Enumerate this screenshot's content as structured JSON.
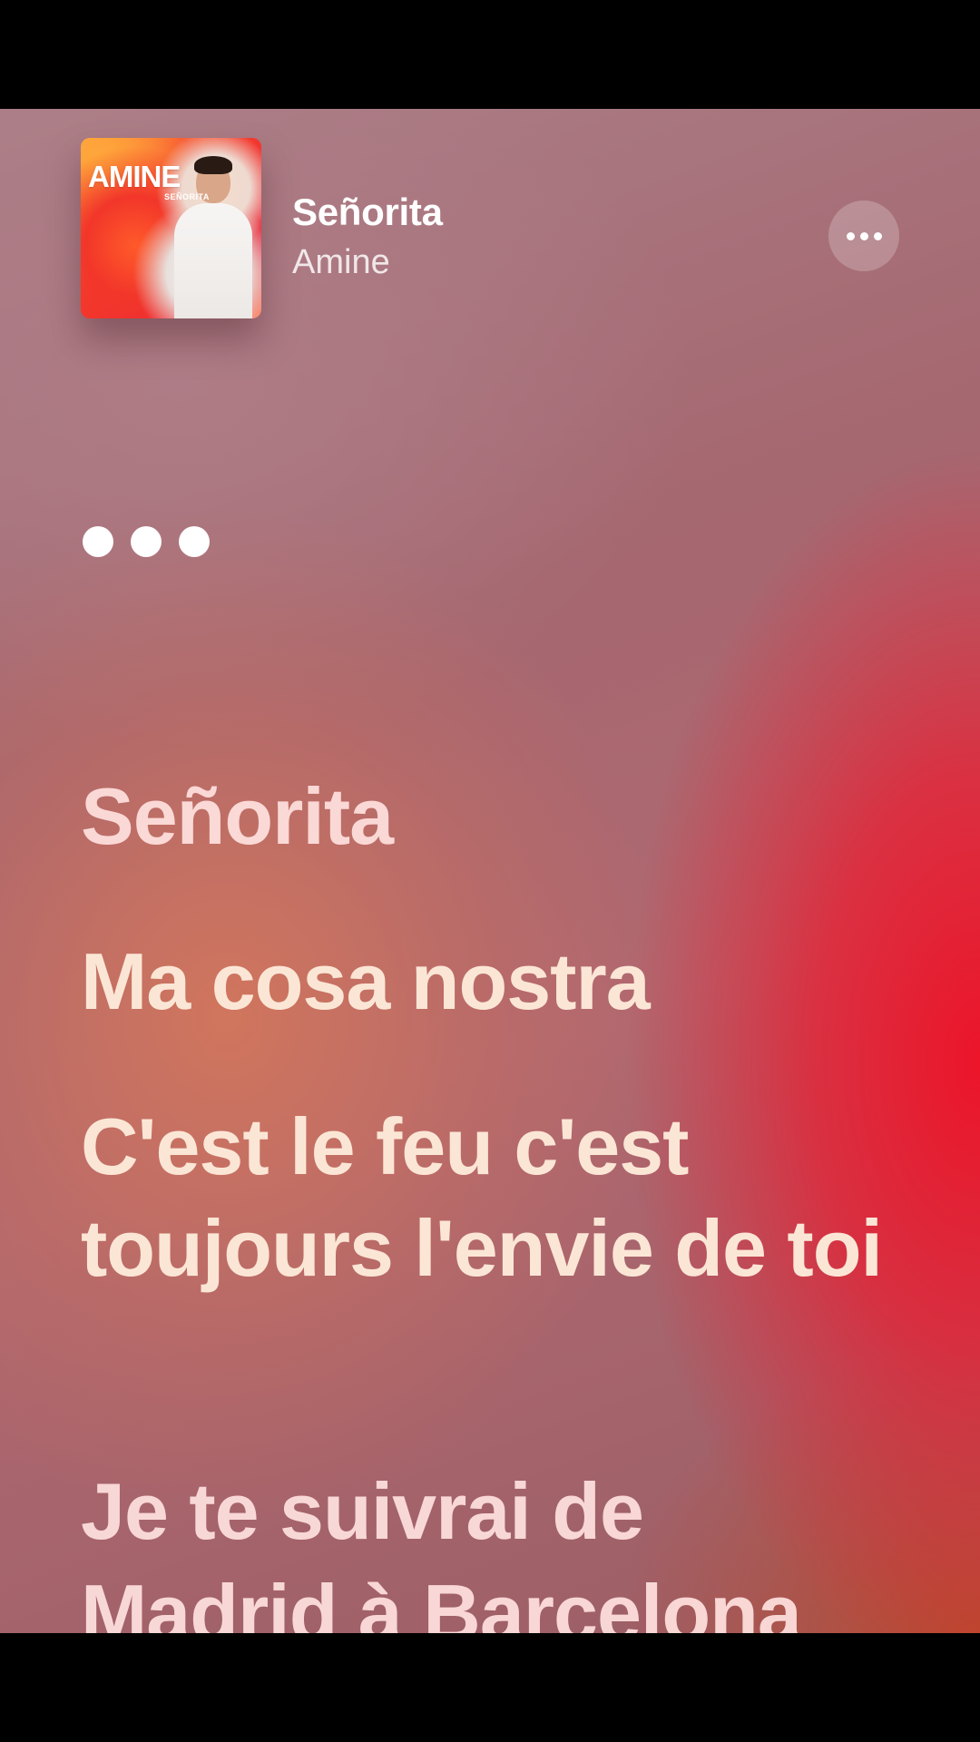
{
  "now_playing": {
    "song_title": "Señorita",
    "artist": "Amine",
    "album_art": {
      "artist_text": "AMINE",
      "title_text": "SEÑORITA"
    },
    "more_icon": "ellipsis-icon"
  },
  "interlude_indicator": {
    "icon": "three-dots-icon"
  },
  "lyrics": [
    "Señorita",
    "Ma cosa nostra",
    "C'est le feu c'est toujours l'envie de toi",
    "Je te suivrai de Madrid à Barcelona"
  ],
  "colors": {
    "accent_red": "#f01026",
    "lyric_active": "#fbe6d6",
    "text_primary": "#ffffff"
  }
}
